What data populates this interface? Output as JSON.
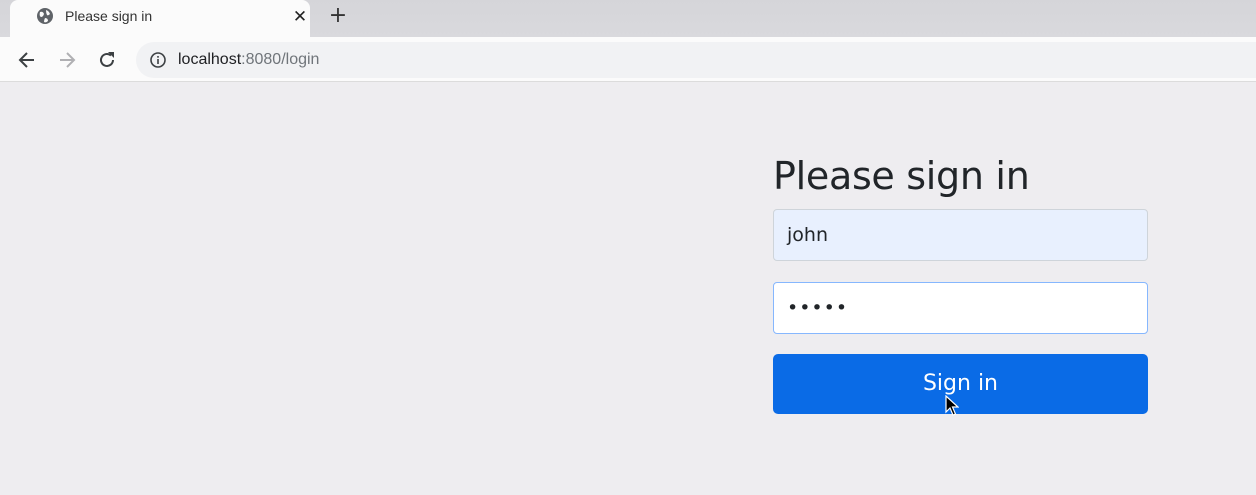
{
  "browser": {
    "tab": {
      "title": "Please sign in",
      "favicon": "globe-icon",
      "close": "✕"
    },
    "new_tab": "+",
    "toolbar": {
      "back": "back-arrow-icon",
      "forward": "forward-arrow-icon",
      "reload": "reload-icon",
      "url_host": "localhost",
      "url_path": ":8080/login",
      "site_info": "info-icon"
    }
  },
  "login": {
    "heading": "Please sign in",
    "username_value": "john",
    "password_value": "•••••",
    "submit_label": "Sign in"
  },
  "colors": {
    "primary": "#0a6be6",
    "page_bg": "#eeedf0",
    "autofill_bg": "#e8f0fe"
  }
}
